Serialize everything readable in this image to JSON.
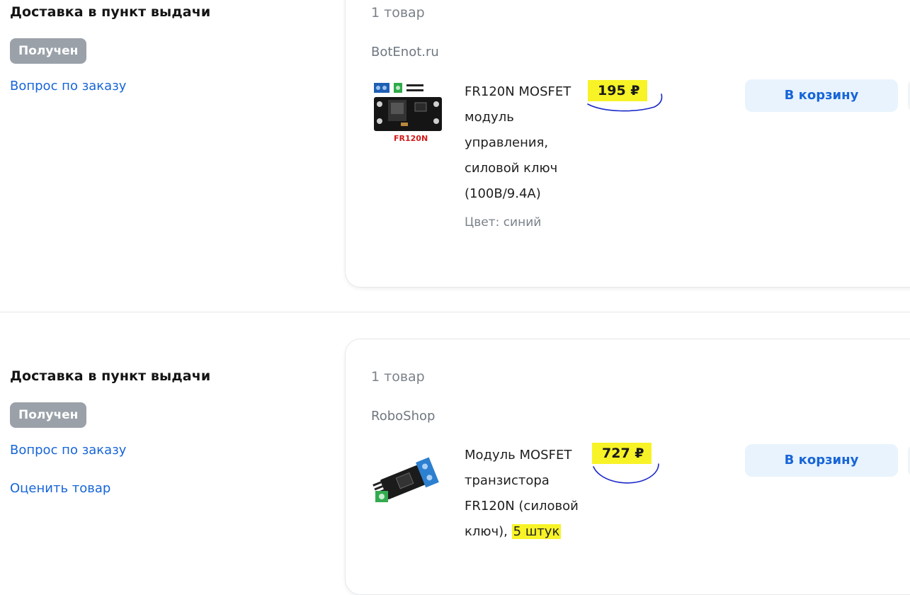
{
  "orders": [
    {
      "delivery_title": "Доставка в пункт выдачи",
      "status": "Получен",
      "links": [
        "Вопрос по заказу"
      ],
      "card": {
        "item_count": "1 товар",
        "seller": "BotEnot.ru",
        "product": {
          "title": "FR120N MOSFET модуль управления, силовой ключ (100В/9.4А)",
          "variant": "Цвет: синий",
          "price": "195 ₽",
          "image_label": "FR120N",
          "cart_label": "В корзину"
        }
      }
    },
    {
      "delivery_title": "Доставка в пункт выдачи",
      "status": "Получен",
      "links": [
        "Вопрос по заказу",
        "Оценить товар"
      ],
      "card": {
        "item_count": "1 товар",
        "seller": "RoboShop",
        "product": {
          "title_main": "Модуль MOSFET транзистора FR120N (силовой ключ),",
          "title_highlight": "5 штук",
          "price": "727 ₽",
          "cart_label": "В корзину"
        }
      }
    }
  ],
  "colors": {
    "link": "#1765d8",
    "badge": "#9aa1a9",
    "highlight": "#f7f327",
    "annotation": "#1a28c8",
    "cart_button_bg": "#e8f3fd"
  },
  "icons": {
    "product_1": "fr120n-module-photo",
    "product_2": "mosfet-module-photo"
  }
}
